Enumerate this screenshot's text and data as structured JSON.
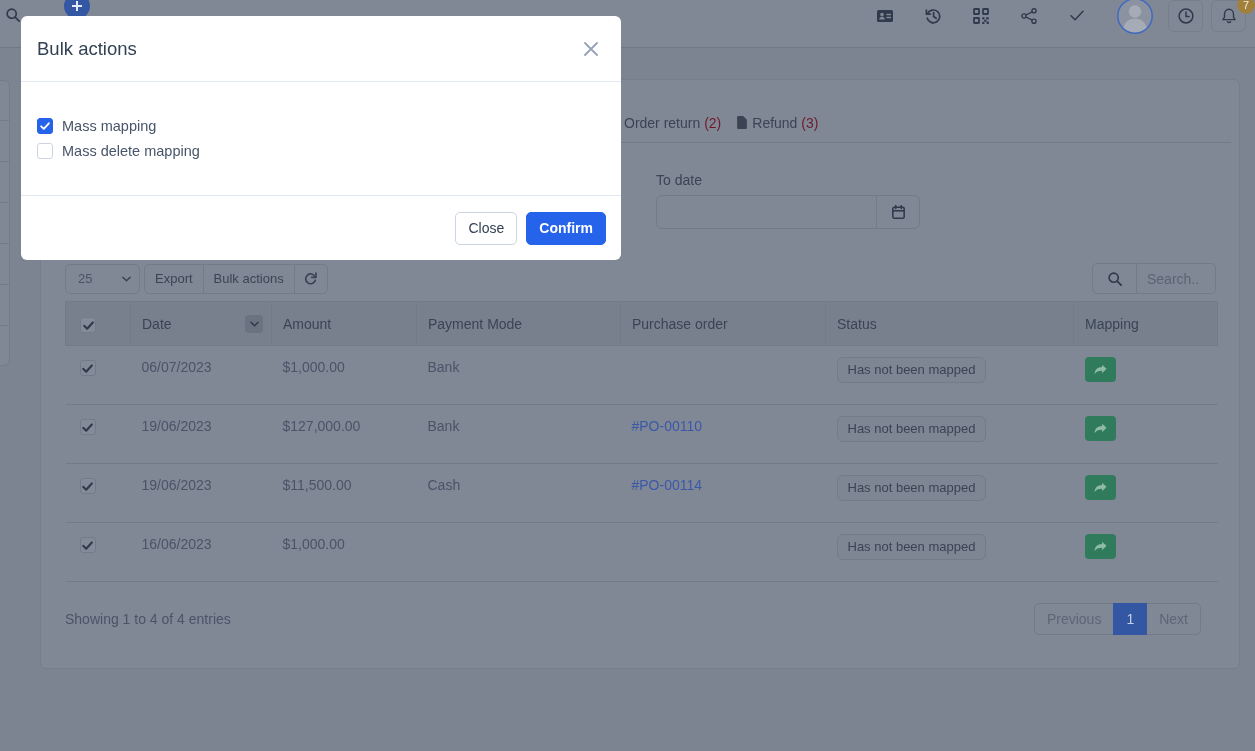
{
  "topbar": {
    "notification_count": "7"
  },
  "tabs": [
    {
      "label": "Order return",
      "count": "(2)",
      "icon": false,
      "selected": false
    },
    {
      "label": "Refund",
      "count": "(3)",
      "icon": true,
      "selected": false
    }
  ],
  "filters": [
    {
      "label": "To date"
    }
  ],
  "toolbar": {
    "page_length": "25",
    "buttons": [
      "Export",
      "Bulk actions"
    ],
    "search": {
      "placeholder": "Search.."
    }
  },
  "table": {
    "select_all": {
      "checked": true
    },
    "columns": [
      {
        "label": "Date",
        "dropdown": true
      },
      {
        "label": "Amount",
        "dropdown": false
      },
      {
        "label": "Payment Mode",
        "dropdown": false
      },
      {
        "label": "Purchase order",
        "dropdown": false
      },
      {
        "label": "Status",
        "dropdown": false
      },
      {
        "label": "Mapping",
        "dropdown": false
      }
    ],
    "rows": [
      {
        "checked": true,
        "date": "06/07/2023",
        "amount": "$1,000.00",
        "payment_mode": "Bank",
        "status": "Has not been mapped"
      },
      {
        "checked": true,
        "date": "19/06/2023",
        "amount": "$127,000.00",
        "payment_mode": "Bank",
        "purchase_order": "#PO-00110",
        "status": "Has not been mapped"
      },
      {
        "checked": true,
        "date": "19/06/2023",
        "amount": "$11,500.00",
        "payment_mode": "Cash",
        "purchase_order": "#PO-00114",
        "status": "Has not been mapped"
      },
      {
        "checked": true,
        "date": "16/06/2023",
        "amount": "$1,000.00",
        "status": "Has not been mapped"
      }
    ]
  },
  "footer": {
    "info": "Showing 1 to 4 of 4 entries",
    "pagination": [
      {
        "label": "Previous",
        "selected": false,
        "disabled": true
      },
      {
        "label": "1",
        "selected": true,
        "disabled": false
      },
      {
        "label": "Next",
        "selected": false,
        "disabled": true
      }
    ]
  },
  "modal": {
    "title": "Bulk actions",
    "options": [
      {
        "label": "Mass mapping",
        "checked": true
      },
      {
        "label": "Mass delete mapping",
        "checked": false
      }
    ],
    "buttons": [
      {
        "label": "Close",
        "kind": "secondary"
      },
      {
        "label": "Confirm",
        "kind": "primary"
      }
    ]
  }
}
